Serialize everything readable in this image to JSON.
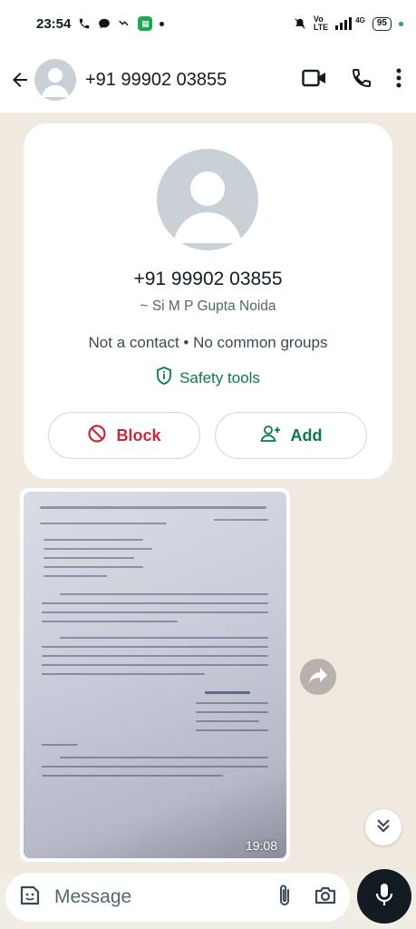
{
  "status_bar": {
    "time": "23:54",
    "battery": "95",
    "network_label": "4G"
  },
  "header": {
    "title": "+91 99902 03855"
  },
  "contact_card": {
    "phone": "+91 99902 03855",
    "name": "~ Si M P Gupta  Noida",
    "status": "Not a contact • No common groups",
    "safety_label": "Safety tools",
    "block_label": "Block",
    "add_label": "Add"
  },
  "image_message": {
    "time": "19:08"
  },
  "composer": {
    "placeholder": "Message"
  },
  "colors": {
    "accent_green": "#0a7a45",
    "block_red": "#c62a3a",
    "chat_bg": "#efe9df"
  }
}
